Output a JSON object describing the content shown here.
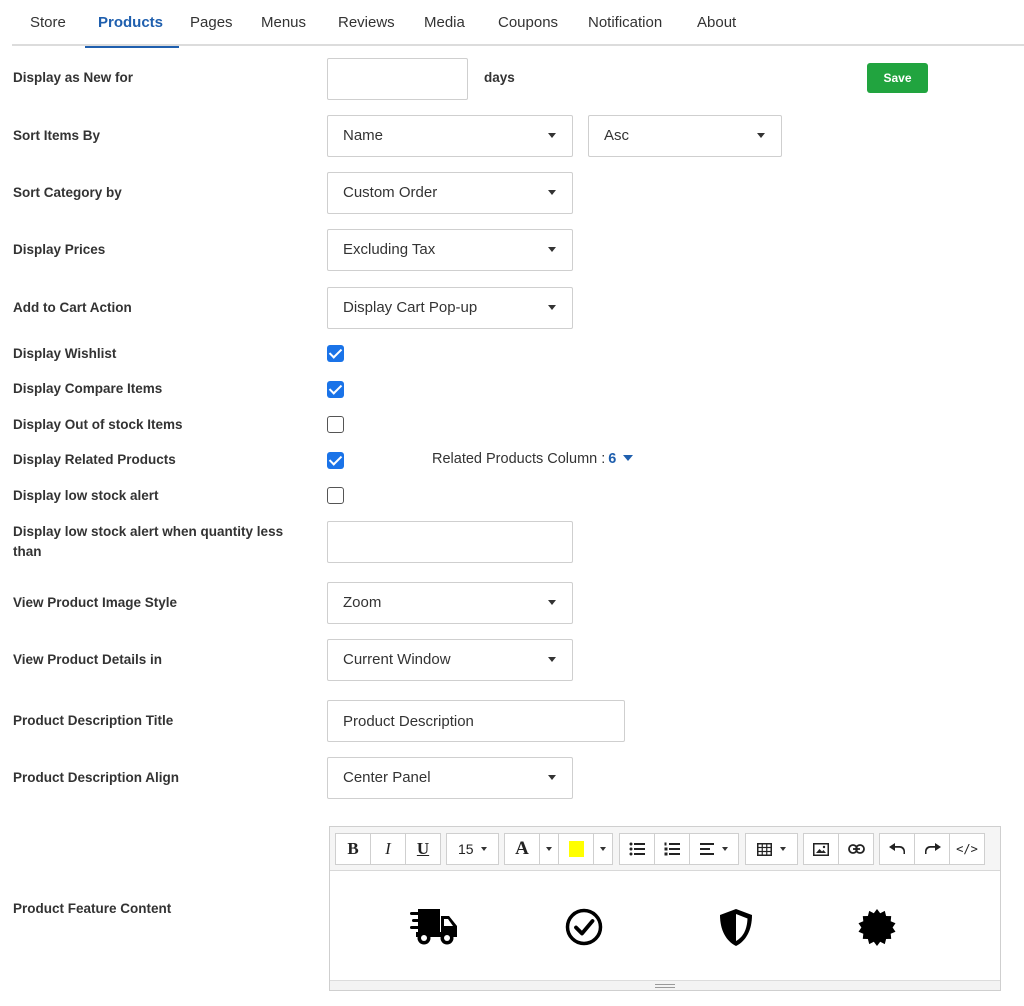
{
  "tabs": [
    {
      "label": "Store"
    },
    {
      "label": "Products"
    },
    {
      "label": "Pages"
    },
    {
      "label": "Menus"
    },
    {
      "label": "Reviews"
    },
    {
      "label": "Media"
    },
    {
      "label": "Coupons"
    },
    {
      "label": "Notification"
    },
    {
      "label": "About"
    }
  ],
  "active_tab": "Products",
  "save_label": "Save",
  "settings": {
    "display_new": {
      "label": "Display as New for",
      "value": "",
      "unit": "days"
    },
    "sort_items": {
      "label": "Sort Items By",
      "value": "Name",
      "order": "Asc"
    },
    "sort_category": {
      "label": "Sort Category by",
      "value": "Custom Order"
    },
    "display_prices": {
      "label": "Display Prices",
      "value": "Excluding Tax"
    },
    "cart_action": {
      "label": "Add to Cart Action",
      "value": "Display Cart Pop-up"
    },
    "wishlist": {
      "label": "Display Wishlist",
      "checked": true
    },
    "compare": {
      "label": "Display Compare Items",
      "checked": true
    },
    "out_of_stock": {
      "label": "Display Out of stock Items",
      "checked": false
    },
    "related": {
      "label": "Display Related Products",
      "checked": true,
      "column_label": "Related Products Column :",
      "column_value": "6"
    },
    "low_stock": {
      "label": "Display low stock alert",
      "checked": false
    },
    "low_stock_qty": {
      "label_line1": "Display low stock alert when quantity less",
      "label_line2": "than",
      "value": ""
    },
    "image_style": {
      "label": "View Product Image Style",
      "value": "Zoom"
    },
    "details_in": {
      "label": "View Product Details in",
      "value": "Current Window"
    },
    "desc_title": {
      "label": "Product Description Title",
      "value": "Product Description"
    },
    "desc_align": {
      "label": "Product Description Align",
      "value": "Center Panel"
    },
    "feature_content": {
      "label": "Product Feature Content"
    }
  },
  "editor": {
    "font_size": "15",
    "bold": "B",
    "italic": "I",
    "underline": "U",
    "font_color": "A",
    "highlight_color": "#ffff00",
    "feature_icons": [
      "delivery-truck-icon",
      "check-circle-icon",
      "shield-icon",
      "badge-icon"
    ]
  }
}
